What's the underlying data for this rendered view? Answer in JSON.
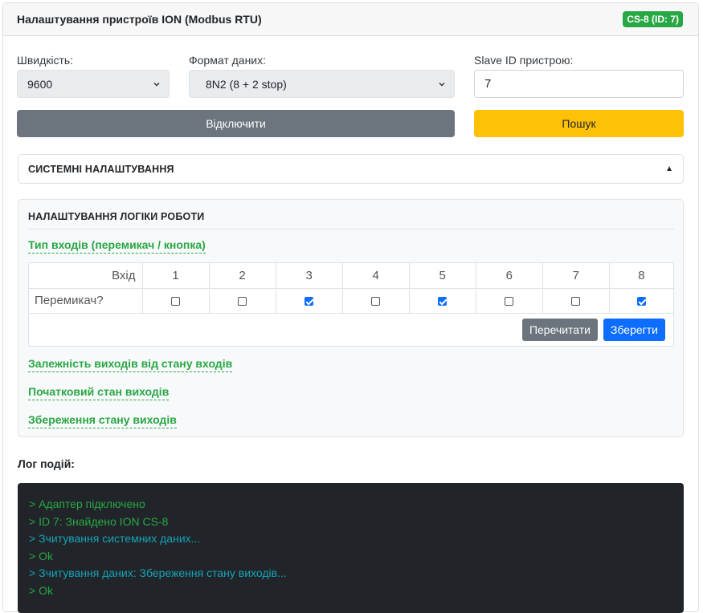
{
  "header": {
    "title": "Налаштування пристроїв ION (Modbus RTU)",
    "badge": "CS-8 (ID: 7)"
  },
  "connection": {
    "speed_label": "Швидкість:",
    "speed_value": "9600",
    "format_label": "Формат даних:",
    "format_value": "8N2 (8 + 2 stop)",
    "slave_label": "Slave ID пристрою:",
    "slave_value": "7",
    "disconnect_label": "Відключити",
    "search_label": "Пошук"
  },
  "system_settings": {
    "title": "СИСТЕМНІ НАЛАШТУВАННЯ",
    "toggle_icon": "▲"
  },
  "logic": {
    "title": "НАЛАШТУВАННЯ ЛОГІКИ РОБОТИ",
    "input_type_link": "Тип входів (перемикач / кнопка)",
    "table": {
      "header_label": "Вхід",
      "row_label": "Перемикач?",
      "columns": [
        "1",
        "2",
        "3",
        "4",
        "5",
        "6",
        "7",
        "8"
      ],
      "checked": [
        false,
        false,
        true,
        false,
        true,
        false,
        false,
        true
      ]
    },
    "reread_label": "Перечитати",
    "save_label": "Зберегти",
    "dependency_link": "Залежність виходів від стану входів",
    "initial_state_link": "Початковий стан виходів",
    "save_state_link": "Збереження стану виходів"
  },
  "log": {
    "title": "Лог подій:",
    "lines": [
      {
        "text": "> Адаптер підключено",
        "color": "#28a745"
      },
      {
        "text": "> ID 7: Знайдено ION CS-8",
        "color": "#28a745"
      },
      {
        "text": "> Зчитування системних даних...",
        "color": "#17a2b8"
      },
      {
        "text": "> Ok",
        "color": "#28a745"
      },
      {
        "text": "> Зчитування даних: Збереження стану виходів...",
        "color": "#17a2b8"
      },
      {
        "text": "> Ok",
        "color": "#28a745"
      }
    ]
  },
  "colors": {
    "accent_green": "#28a745",
    "accent_blue": "#0d6efd",
    "warning": "#ffc107",
    "dark_button": "#6c757d",
    "log_bg": "#212529"
  }
}
